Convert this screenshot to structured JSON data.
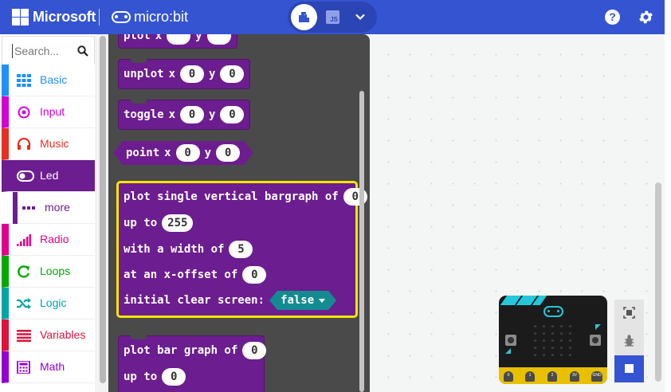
{
  "header": {
    "brand": "Microsoft",
    "product": "micro:bit",
    "editor_mode_blocks": "Blocks",
    "editor_mode_js": "JS",
    "accent_color": "#3454d1"
  },
  "toolbox": {
    "search_placeholder": "Search...",
    "categories": [
      {
        "label": "Basic",
        "color": "#1e90ff",
        "icon": "grid-icon"
      },
      {
        "label": "Input",
        "color": "#d400d4",
        "icon": "target-icon"
      },
      {
        "label": "Music",
        "color": "#e63022",
        "icon": "headphones-icon"
      },
      {
        "label": "Led",
        "color": "#6c1d8f",
        "icon": "toggle-icon",
        "selected": true
      },
      {
        "label": "more",
        "color": "#6c1d8f",
        "icon": "ellipsis-icon"
      },
      {
        "label": "Radio",
        "color": "#e3008c",
        "icon": "signal-icon"
      },
      {
        "label": "Loops",
        "color": "#00aa00",
        "icon": "refresh-icon"
      },
      {
        "label": "Logic",
        "color": "#00a4a6",
        "icon": "shuffle-icon"
      },
      {
        "label": "Variables",
        "color": "#dc143c",
        "icon": "list-icon"
      },
      {
        "label": "Math",
        "color": "#9400d3",
        "icon": "calculator-icon"
      }
    ]
  },
  "flyout": {
    "plot": {
      "label": "plot",
      "x_label": "x",
      "y_label": "y"
    },
    "unplot": {
      "label": "unplot",
      "x_label": "x",
      "x_value": "0",
      "y_label": "y",
      "y_value": "0"
    },
    "toggle": {
      "label": "toggle",
      "x_label": "x",
      "x_value": "0",
      "y_label": "y",
      "y_value": "0"
    },
    "point": {
      "label": "point",
      "x_label": "x",
      "x_value": "0",
      "y_label": "y",
      "y_value": "0"
    },
    "bargraph": {
      "line1": "plot single vertical bargraph of",
      "value": "0",
      "line2": "up to",
      "up_to": "255",
      "line3": "with a width of",
      "width": "5",
      "line4": "at an x-offset of",
      "offset": "0",
      "line5": "initial clear screen:",
      "clear": "false"
    },
    "bar_graph": {
      "line1": "plot bar graph of",
      "value": "0",
      "line2": "up to",
      "up_to": "0"
    }
  },
  "simulator": {
    "pins": [
      "0",
      "1",
      "2",
      "3V",
      "GND"
    ]
  },
  "colors": {
    "led_category": "#6c1d8f",
    "highlight": "#f5e600",
    "logic_dropdown": "#138b91"
  }
}
